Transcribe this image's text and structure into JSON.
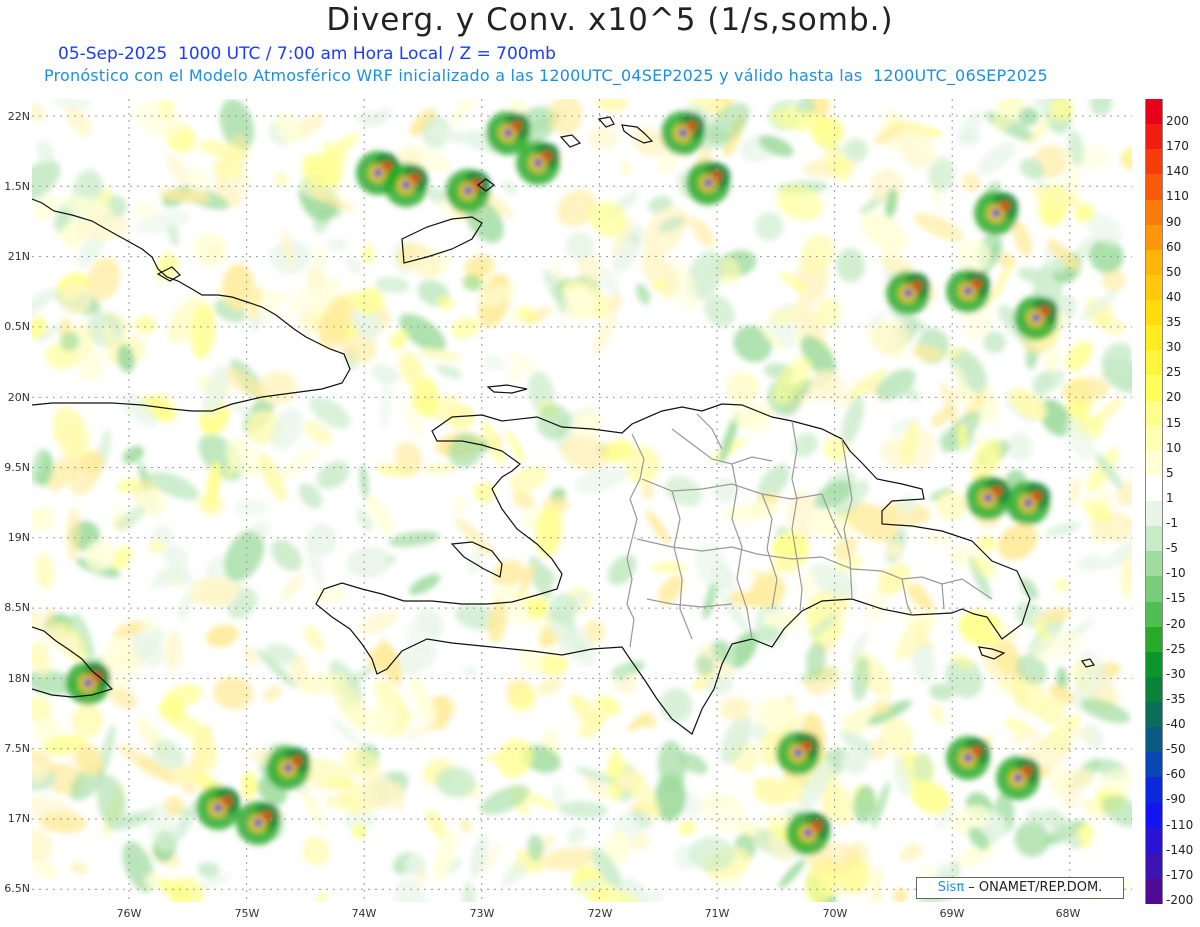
{
  "header": {
    "title": "Diverg. y Conv. x10^5 (1/s,somb.)",
    "subtitle_line1": "05-Sep-2025  1000 UTC / 7:00 am Hora Local / Z = 700mb",
    "subtitle_line2": "Pronóstico con el Modelo Atmosférico WRF inicializado a las 1200UTC_04SEP2025 y válido hasta las  1200UTC_06SEP2025"
  },
  "axes": {
    "lat_labels": [
      "22N",
      "1.5N",
      "21N",
      "0.5N",
      "20N",
      "9.5N",
      "19N",
      "8.5N",
      "18N",
      "7.5N",
      "17N",
      "6.5N"
    ],
    "lon_labels": [
      "76W",
      "75W",
      "74W",
      "73W",
      "72W",
      "71W",
      "70W",
      "69W",
      "68W"
    ]
  },
  "colorbar": {
    "labels": [
      "200",
      "170",
      "140",
      "110",
      "90",
      "60",
      "50",
      "40",
      "35",
      "30",
      "25",
      "20",
      "15",
      "10",
      "5",
      "1",
      "-1",
      "-5",
      "-10",
      "-15",
      "-20",
      "-25",
      "-30",
      "-35",
      "-40",
      "-50",
      "-60",
      "-90",
      "-110",
      "-140",
      "-170",
      "-200"
    ],
    "colors": [
      "#e8001a",
      "#f01e10",
      "#f53c0a",
      "#f85a0a",
      "#fa7a0a",
      "#fc960a",
      "#ffb40a",
      "#ffc80a",
      "#ffdc0a",
      "#ffec20",
      "#fff53c",
      "#ffff5a",
      "#ffff8c",
      "#ffffb4",
      "#ffffd8",
      "#ffffff",
      "#e6f5e6",
      "#c8ebc8",
      "#a0dca0",
      "#78cd78",
      "#50be50",
      "#28aa28",
      "#0a9628",
      "#0a823c",
      "#0a6e5a",
      "#0a5a82",
      "#0a46b4",
      "#0a28dc",
      "#1414f0",
      "#2814d2",
      "#3c14b4",
      "#500a96"
    ]
  },
  "credit": {
    "sis": "Sisπ",
    "rest": " – ONAMET/REP.DOM."
  }
}
